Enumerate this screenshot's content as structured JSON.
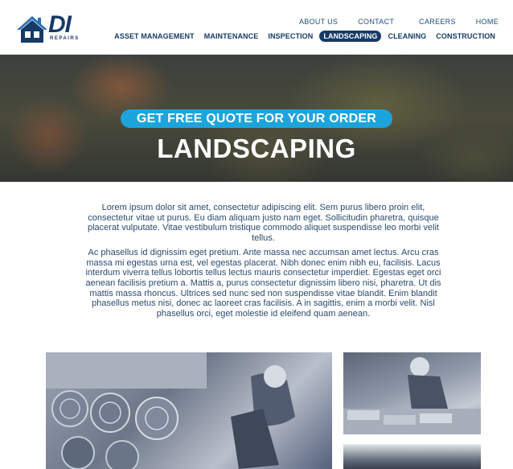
{
  "brand": {
    "logo_text": "DI",
    "logo_sub": "REPAIRS",
    "logo_color": "#163a66"
  },
  "top_nav": {
    "items": [
      "ABOUT US",
      "CONTACT",
      "CAREERS",
      "HOME"
    ]
  },
  "main_nav": {
    "items": [
      "ASSET MANAGEMENT",
      "MAINTENANCE",
      "INSPECTION",
      "LANDSCAPING",
      "CLEANING",
      "CONSTRUCTION"
    ],
    "active": "LANDSCAPING"
  },
  "hero": {
    "quote_label": "GET FREE QUOTE FOR YOUR ORDER",
    "title": "LANDSCAPING",
    "accent": "#1ea4dc"
  },
  "content": {
    "paragraphs": [
      "Lorem ipsum dolor sit amet, consectetur adipiscing elit. Sem purus libero proin elit, consectetur vitae ut purus. Eu diam aliquam justo nam eget. Sollicitudin pharetra, quisque placerat vulputate. Vitae vestibulum tristique commodo aliquet suspendisse leo morbi velit tellus.",
      "Ac phasellus id dignissim eget pretium. Ante massa nec accumsan amet lectus. Arcu cras massa mi egestas urna est, vel egestas placerat. Nibh donec enim nibh eu, facilisis. Lacus interdum viverra tellus lobortis tellus lectus mauris consectetur imperdiet. Egestas eget orci aenean facilisis pretium a. Mattis a, purus consectetur dignissim libero nisi, pharetra. Ut dis mattis massa rhoncus. Ultrices sed nunc sed non suspendisse vitae blandit. Enim blandit phasellus metus nisi, donec ac laoreet cras facilisis. A in sagittis, enim a morbi velit. Nisl phasellus orci, eget molestie id eleifend quam aenean."
    ]
  },
  "gallery": {
    "images": [
      "landscaping-turf-rolls-photo",
      "paving-worker-photo",
      "garden-work-photo"
    ]
  }
}
